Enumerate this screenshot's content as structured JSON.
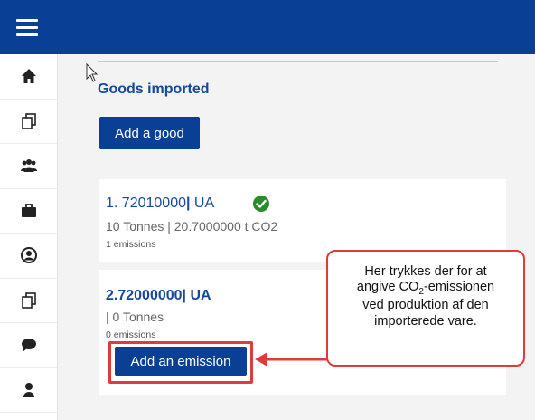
{
  "colors": {
    "primary": "#0a3f96",
    "link": "#144a9c",
    "success": "#2a8c2a",
    "highlight": "#e03b3b"
  },
  "sidebar": {
    "items": [
      {
        "icon": "home-icon"
      },
      {
        "icon": "documents-icon"
      },
      {
        "icon": "users-icon"
      },
      {
        "icon": "briefcase-icon"
      },
      {
        "icon": "account-circle-icon"
      },
      {
        "icon": "documents-icon"
      },
      {
        "icon": "chat-icon"
      },
      {
        "icon": "user-icon"
      }
    ]
  },
  "main": {
    "section_title": "Goods imported",
    "add_good_label": "Add a good",
    "goods": [
      {
        "prefix": "1. ",
        "code": "72010000",
        "sep": "|",
        "country": " UA",
        "summary": "10 Tonnes | 20.7000000 t CO2",
        "emissions_count": "1 emissions",
        "status_icon": "check-circle-icon"
      },
      {
        "prefix": "2.",
        "code": "72000000",
        "sep": "|",
        "country": " UA",
        "summary": "| 0 Tonnes",
        "emissions_count": "0 emissions",
        "add_emission_label": "Add an emission"
      }
    ]
  },
  "callout": {
    "line1": "Her trykkes der for at",
    "line2_pre": "angive CO",
    "line2_sub": "2",
    "line2_post": "-emissionen",
    "line3": "ved produktion af den",
    "line4": "importerede vare."
  }
}
